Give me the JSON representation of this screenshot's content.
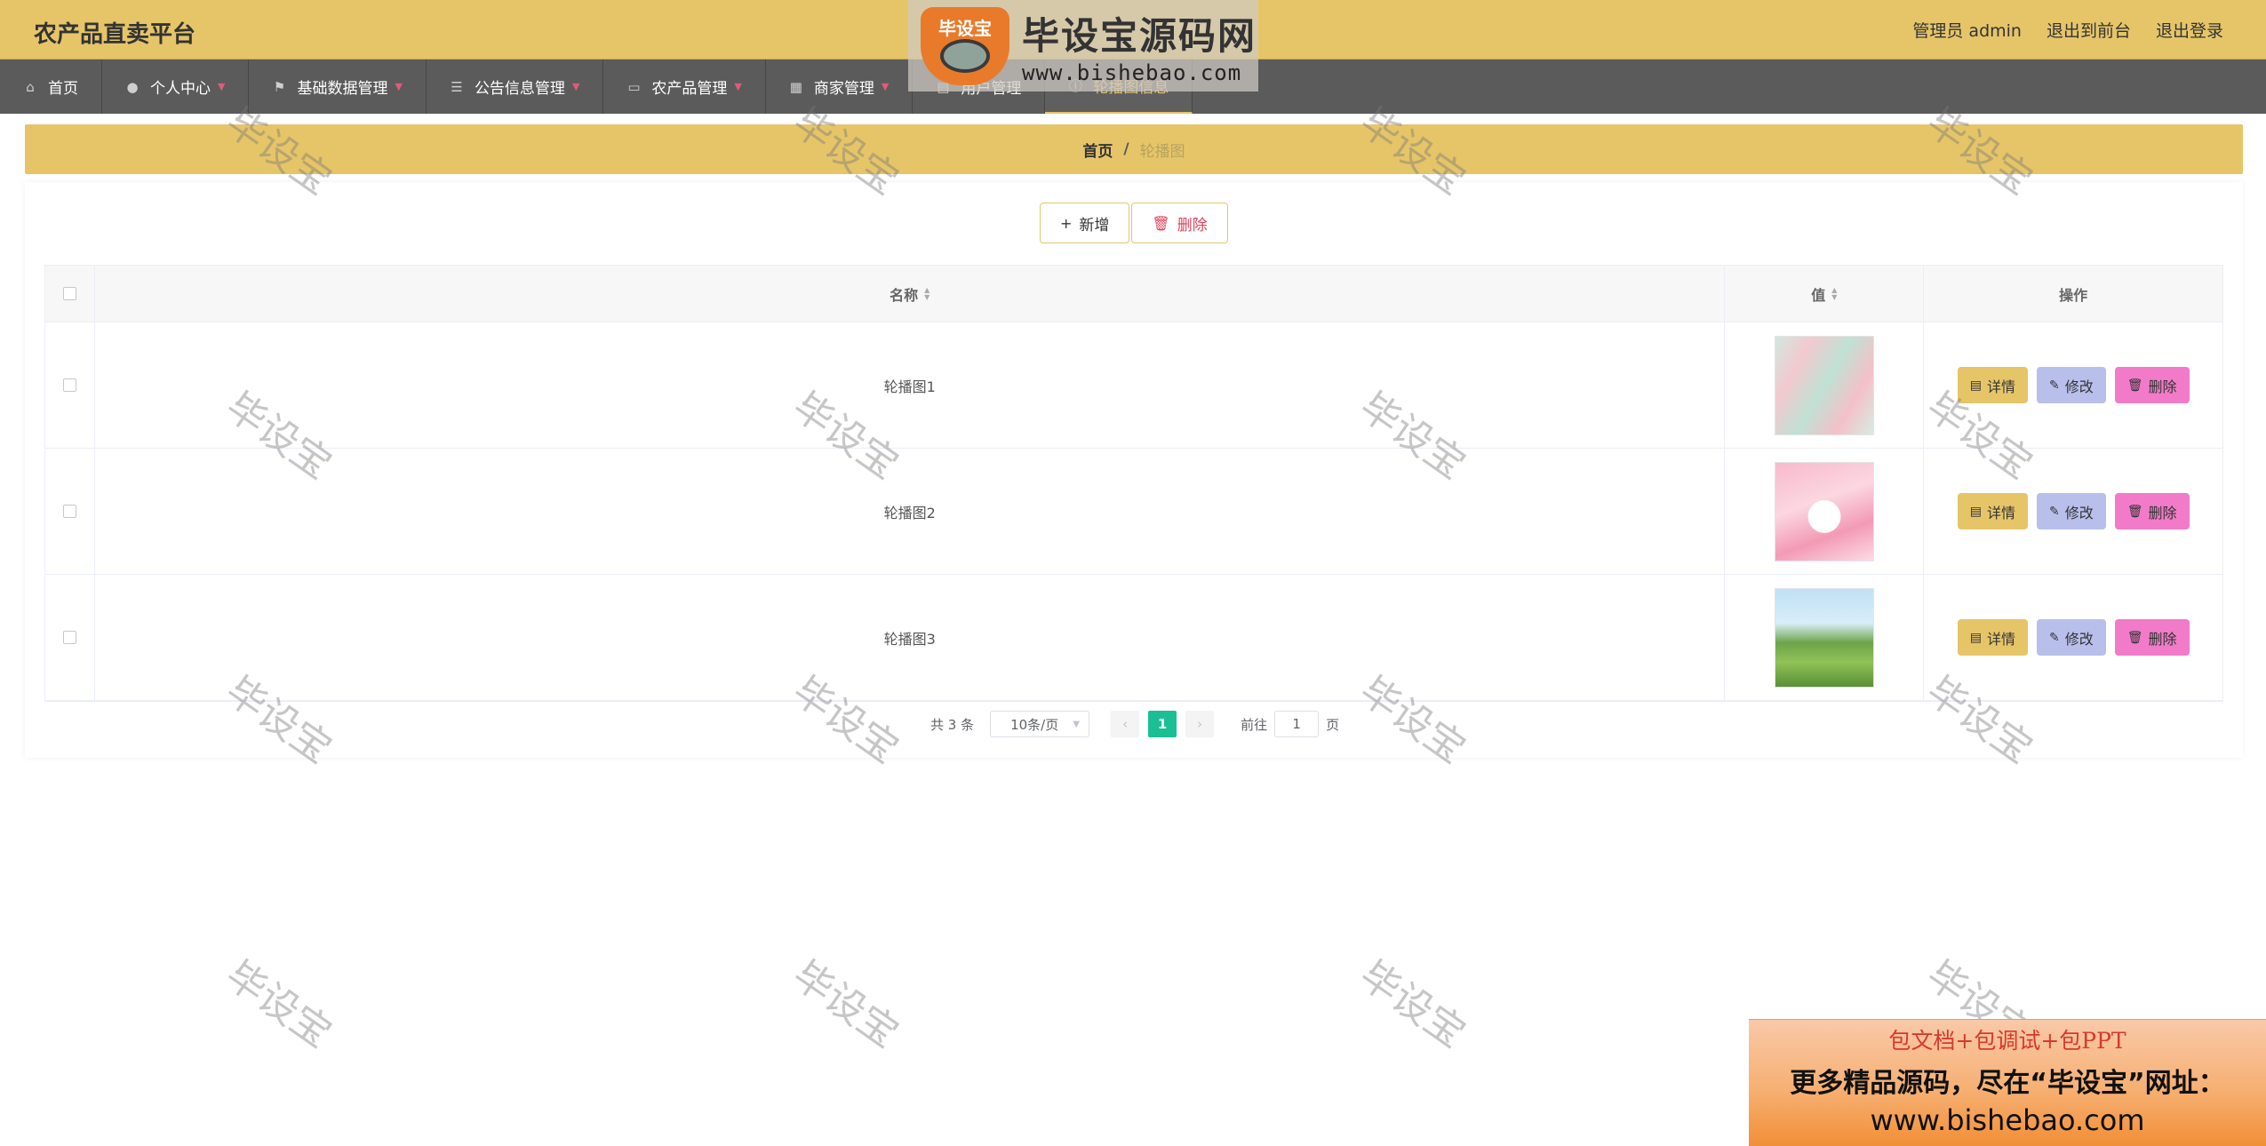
{
  "header": {
    "app_title": "农产品直卖平台",
    "admin_label": "管理员 admin",
    "front_link": "退出到前台",
    "logout_link": "退出登录"
  },
  "nav": [
    {
      "label": "首页",
      "icon": "home-icon",
      "has_caret": false
    },
    {
      "label": "个人中心",
      "icon": "user-icon",
      "has_caret": true
    },
    {
      "label": "基础数据管理",
      "icon": "flag-icon",
      "has_caret": true
    },
    {
      "label": "公告信息管理",
      "icon": "sliders-icon",
      "has_caret": true
    },
    {
      "label": "农产品管理",
      "icon": "chat-icon",
      "has_caret": true
    },
    {
      "label": "商家管理",
      "icon": "grid-icon",
      "has_caret": true
    },
    {
      "label": "用户管理",
      "icon": "list-icon",
      "has_caret": false
    },
    {
      "label": "轮播图信息",
      "icon": "info-icon",
      "has_caret": false,
      "active": true
    }
  ],
  "breadcrumb": {
    "home": "首页",
    "separator": "/",
    "current": "轮播图"
  },
  "toolbar": {
    "add_label": "新增",
    "delete_label": "删除"
  },
  "table": {
    "columns": {
      "name": "名称",
      "value": "值",
      "ops": "操作"
    },
    "rows": [
      {
        "name": "轮播图1",
        "image": "carousel-1"
      },
      {
        "name": "轮播图2",
        "image": "carousel-2"
      },
      {
        "name": "轮播图3",
        "image": "carousel-3"
      }
    ],
    "op_labels": {
      "detail": "详情",
      "edit": "修改",
      "delete": "删除"
    }
  },
  "pagination": {
    "total_text": "共 3 条",
    "page_size": "10条/页",
    "current_page": "1",
    "goto_prefix": "前往",
    "goto_value": "1",
    "goto_suffix": "页"
  },
  "watermark": {
    "logo_badge": "毕设宝",
    "brand_title": "毕设宝源码网",
    "brand_url": "www.bishebao.com",
    "diagonal_text": "毕设宝"
  },
  "promo": {
    "line1": "包文档+包调试+包PPT",
    "line2": "更多精品源码，尽在“毕设宝”网址：",
    "line3": "www.bishebao.com"
  },
  "colors": {
    "accent": "#e6c569",
    "nav_bg": "#5b5b5b",
    "page_active": "#1bbf94",
    "edit_btn": "#b9bfeb",
    "delete_btn": "#f17bc9"
  }
}
